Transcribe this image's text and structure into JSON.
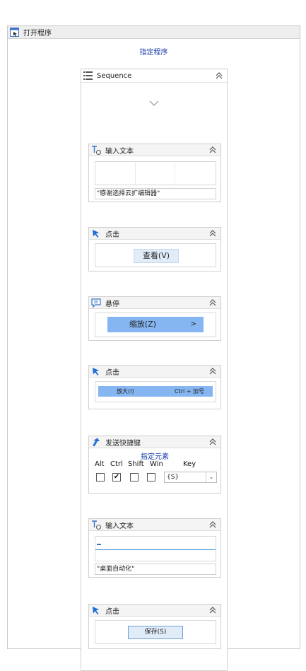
{
  "outer": {
    "title": "打开程序",
    "link": "指定程序"
  },
  "sequence": {
    "title": "Sequence"
  },
  "activities": [
    {
      "title": "输入文本",
      "value": "\"感谢选择云扩编辑器\""
    },
    {
      "title": "点击",
      "preview_label": "查看(V)"
    },
    {
      "title": "悬停",
      "preview_label": "缩放(Z)",
      "preview_arrow": ">"
    },
    {
      "title": "点击",
      "preview_label": "放大(I)",
      "preview_shortcut": "Ctrl + 加号"
    },
    {
      "title": "发送快捷键",
      "link": "指定元素",
      "keys": [
        "Alt",
        "Ctrl",
        "Shift",
        "Win"
      ],
      "key_header": "Key",
      "checked": [
        false,
        true,
        false,
        false
      ],
      "key_value": "{S}"
    },
    {
      "title": "输入文本",
      "value": "\"桌面自动化\""
    },
    {
      "title": "点击",
      "preview_label": "保存(S)"
    }
  ],
  "colors": {
    "link": "#1b3ca8",
    "highlight": "#85b6f1",
    "click_icon": "#1f6fd6"
  }
}
